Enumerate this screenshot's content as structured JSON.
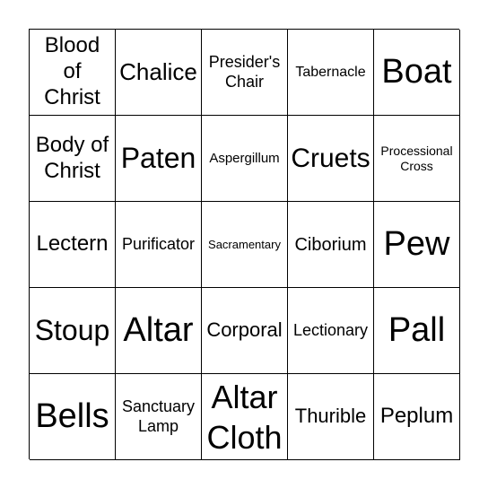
{
  "board": {
    "cells": [
      "Blood\nof\nChrist",
      "Chalice",
      "Presider's\nChair",
      "Tabernacle",
      "Boat",
      "Body of\nChrist",
      "Paten",
      "Aspergillum",
      "Cruets",
      "Processional\nCross",
      "Lectern",
      "Purificator",
      "Sacramentary",
      "Ciborium",
      "Pew",
      "Stoup",
      "Altar",
      "Corporal",
      "Lectionary",
      "Pall",
      "Bells",
      "Sanctuary\nLamp",
      "Altar\nCloth",
      "Thurible",
      "Peplum"
    ]
  }
}
